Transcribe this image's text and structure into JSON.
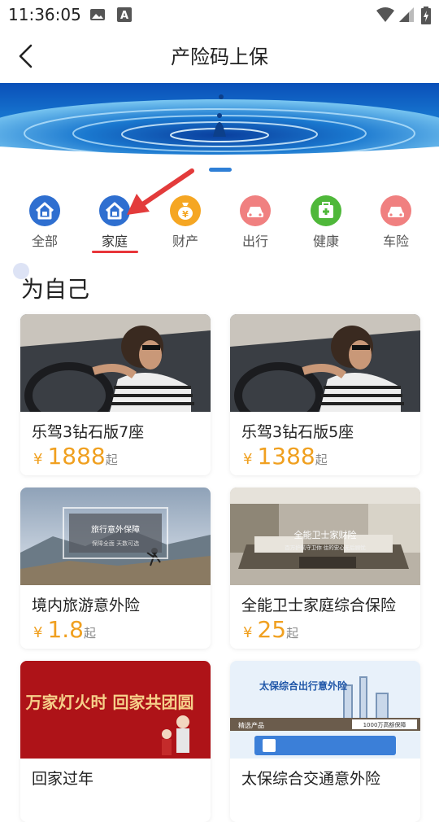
{
  "status": {
    "time": "11:36:05"
  },
  "header": {
    "title": "产险码上保"
  },
  "categories": [
    {
      "label": "全部",
      "color": "#2f6fd0",
      "icon": "home-icon"
    },
    {
      "label": "家庭",
      "color": "#2f6fd0",
      "icon": "home-icon"
    },
    {
      "label": "财产",
      "color": "#f5a623",
      "icon": "money-bag-icon"
    },
    {
      "label": "出行",
      "color": "#f08080",
      "icon": "car-icon"
    },
    {
      "label": "健康",
      "color": "#4fb83a",
      "icon": "medical-kit-icon"
    },
    {
      "label": "车险",
      "color": "#f08080",
      "icon": "car-icon"
    }
  ],
  "active_category": "家庭",
  "section": {
    "title": "为自己"
  },
  "products": [
    {
      "name": "乐驾3钻石版7座",
      "currency": "¥",
      "price": "1888",
      "suffix": "起"
    },
    {
      "name": "乐驾3钻石版5座",
      "currency": "¥",
      "price": "1388",
      "suffix": "起"
    },
    {
      "name": "境内旅游意外险",
      "currency": "¥",
      "price": "1.8",
      "suffix": "起",
      "image_text": [
        "旅行意外保障",
        "保障全面 天数可选"
      ]
    },
    {
      "name": "全能卫士家庭综合保险",
      "currency": "¥",
      "price": "25",
      "suffix": "起",
      "image_text": [
        "全能卫士家财险",
        "百万护航守卫你 住的安心无后顾忧"
      ]
    },
    {
      "name": "回家过年",
      "image_text": [
        "万家灯火时 回家共团圆"
      ]
    },
    {
      "name": "太保综合交通意外险",
      "image_text": [
        "太保综合出行意外险",
        "精选产品",
        "1000万高额保障"
      ]
    }
  ],
  "colors": {
    "accent": "#2f7fd6",
    "price": "#f0a020",
    "indicator": "#e8353a"
  }
}
